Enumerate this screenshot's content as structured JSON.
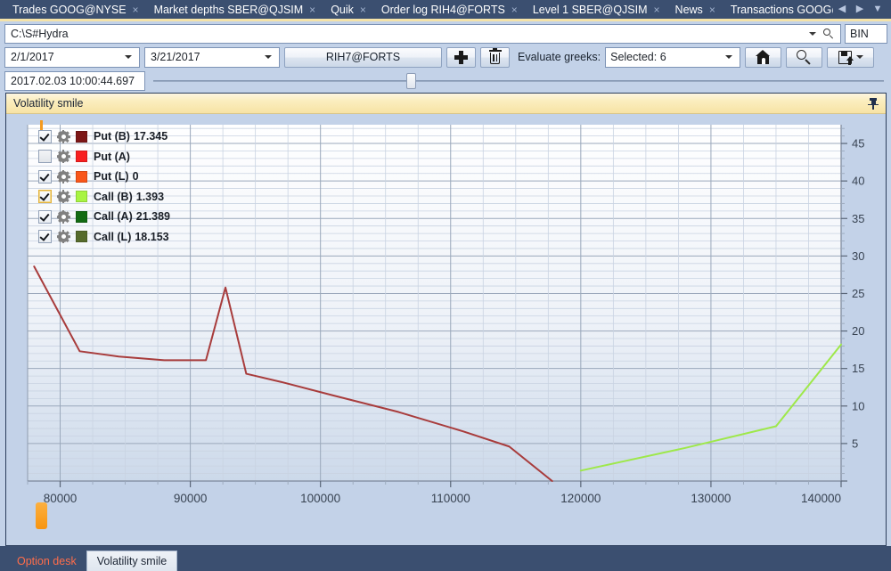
{
  "tabbar": {
    "tabs": [
      {
        "label": "Trades GOOG@NYSE",
        "close": "×"
      },
      {
        "label": "Market depths SBER@QJSIM",
        "close": "×"
      },
      {
        "label": "Quik",
        "close": "×"
      },
      {
        "label": "Order log RIH4@FORTS",
        "close": "×"
      },
      {
        "label": "Level 1 SBER@QJSIM",
        "close": "×"
      },
      {
        "label": "News",
        "close": "×"
      },
      {
        "label": "Transactions GOOG@NYSE",
        "close": ""
      }
    ],
    "nav_prev": "◀",
    "nav_next": "▶",
    "nav_list": "▼"
  },
  "pathbar": {
    "path": "C:\\S#Hydra",
    "bin_label": "BIN"
  },
  "toolbar": {
    "date_from": "2/1/2017",
    "date_to": "3/21/2017",
    "security_button": "RIH7@FORTS",
    "add_label": "",
    "delete_label": "",
    "greeks_label": "Evaluate greeks:",
    "greeks_value": "Selected: 6",
    "home_label": "",
    "search_label": "",
    "save_label": ""
  },
  "timerow": {
    "timestamp": "2017.02.03 10:00:44.697"
  },
  "panel": {
    "title": "Volatility smile"
  },
  "bottom_tabs": [
    {
      "label": "Option desk",
      "active": true
    },
    {
      "label": "Volatility smile",
      "active": false
    }
  ],
  "legend": [
    {
      "label": "Put (B)",
      "value": "17.345",
      "color": "#7d1616",
      "checked": true,
      "selected": false
    },
    {
      "label": "Put (A)",
      "value": "",
      "color": "#f82020",
      "checked": false,
      "selected": false
    },
    {
      "label": "Put (L)",
      "value": "0",
      "color": "#f9561a",
      "checked": true,
      "selected": false
    },
    {
      "label": "Call (B)",
      "value": "1.393",
      "color": "#a8f442",
      "checked": true,
      "selected": true
    },
    {
      "label": "Call (A)",
      "value": "21.389",
      "color": "#136b13",
      "checked": true,
      "selected": false
    },
    {
      "label": "Call (L)",
      "value": "18.153",
      "color": "#566b2c",
      "checked": true,
      "selected": false
    }
  ],
  "chart_data": {
    "type": "line",
    "title": "Volatility smile",
    "xlabel": "",
    "ylabel": "",
    "xlim": [
      77500,
      140000
    ],
    "ylim": [
      0,
      47.5
    ],
    "xticks": [
      80000,
      90000,
      100000,
      110000,
      120000,
      130000,
      140000
    ],
    "yticks": [
      5,
      10,
      15,
      20,
      25,
      30,
      35,
      40,
      45
    ],
    "grid": true,
    "legend_position": "top-left",
    "series": [
      {
        "name": "Put (B)",
        "color": "#a83c3c",
        "x": [
          78000,
          81500,
          84500,
          88000,
          91200,
          92700,
          94300,
          97000,
          101000,
          106000,
          111000,
          114500,
          117800
        ],
        "y": [
          28.6,
          17.3,
          16.6,
          16.1,
          16.1,
          25.8,
          14.3,
          13.2,
          11.4,
          9.2,
          6.6,
          4.6,
          0.0
        ]
      },
      {
        "name": "Call (B)",
        "color": "#9ee84a",
        "x": [
          120000,
          128000,
          135000,
          140000
        ],
        "y": [
          1.39,
          4.4,
          7.3,
          18.2
        ]
      }
    ]
  }
}
